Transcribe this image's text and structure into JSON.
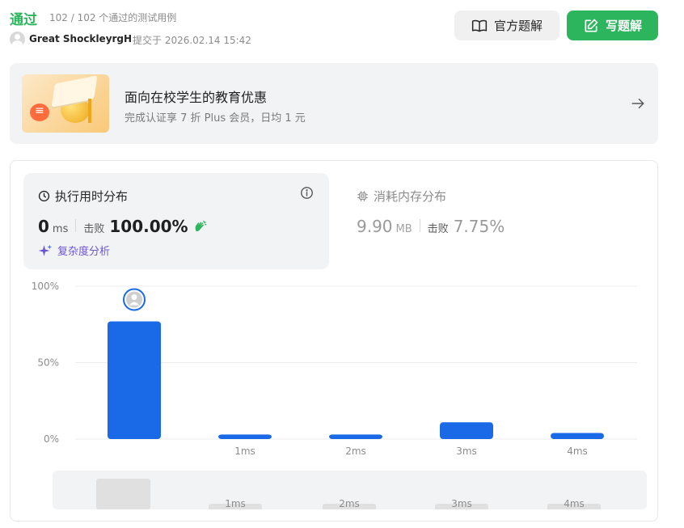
{
  "header": {
    "status": "通过",
    "passed_text": "102 / 102 个通过的测试用例",
    "username": "Great ShockleyrgH",
    "submitted_text": "提交于 2026.02.14 15:42",
    "official_button": "官方题解",
    "write_button": "写题解"
  },
  "promo": {
    "title": "面向在校学生的教育优惠",
    "subtitle": "完成认证享 7 折 Plus 会员，日均 1 元"
  },
  "runtime": {
    "title": "执行用时分布",
    "value": "0",
    "unit": "ms",
    "beats_label": "击败",
    "beats_value": "100.00%",
    "complexity_link": "复杂度分析"
  },
  "memory": {
    "title": "消耗内存分布",
    "value": "9.90",
    "unit": "MB",
    "beats_label": "击败",
    "beats_value": "7.75%"
  },
  "colors": {
    "accept": "#2db55d",
    "bar": "#1a6ae8",
    "complexity": "#6e56cf"
  },
  "chart_data": {
    "type": "bar",
    "categories": [
      "",
      "1ms",
      "2ms",
      "3ms",
      "4ms"
    ],
    "values": [
      77,
      3,
      3,
      11,
      4
    ],
    "ylim": [
      0,
      100
    ],
    "yticks": [
      "100%",
      "50%",
      "0%"
    ],
    "ytick_values": [
      100,
      50,
      0
    ],
    "highlight_index": 0,
    "grid": true
  },
  "scrubber": {
    "labels": [
      "1ms",
      "2ms",
      "3ms",
      "4ms"
    ]
  }
}
